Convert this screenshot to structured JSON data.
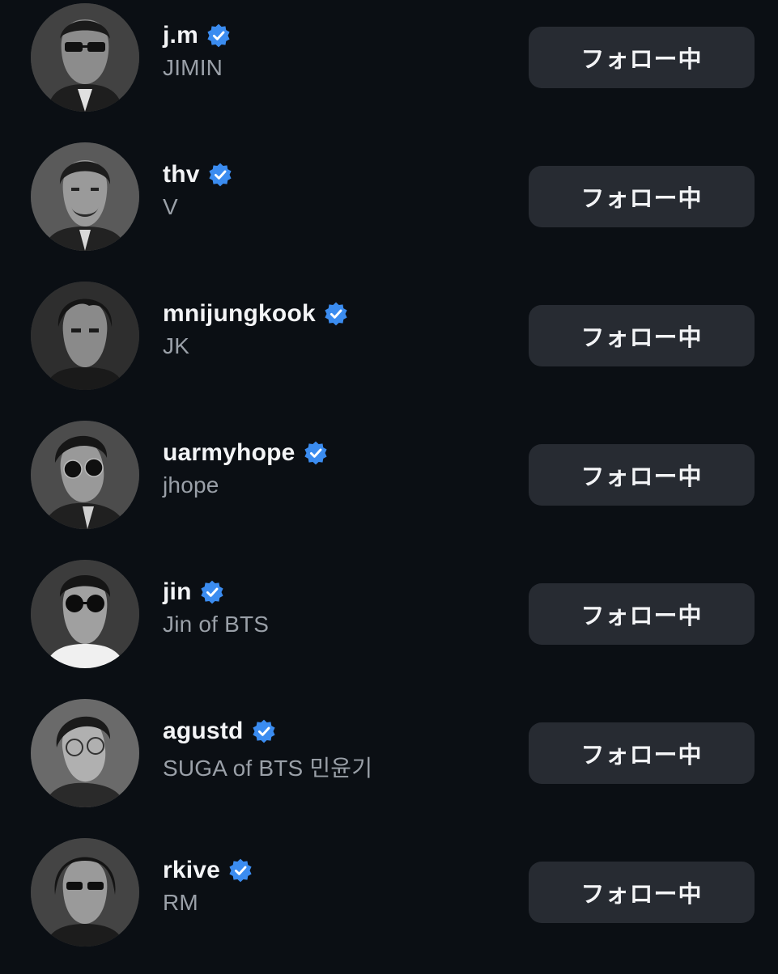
{
  "colors": {
    "background": "#0b0f14",
    "button_bg": "#272b32",
    "verified_blue": "#3b8cf0",
    "secondary_text": "#9aa0a8"
  },
  "accounts": [
    {
      "username": "j.m",
      "display_name": "JIMIN",
      "verified": true,
      "follow_label": "フォロー中",
      "avatar_icon": "avatar-photo"
    },
    {
      "username": "thv",
      "display_name": "V",
      "verified": true,
      "follow_label": "フォロー中",
      "avatar_icon": "avatar-photo"
    },
    {
      "username": "mnijungkook",
      "display_name": "JK",
      "verified": true,
      "follow_label": "フォロー中",
      "avatar_icon": "avatar-photo"
    },
    {
      "username": "uarmyhope",
      "display_name": "jhope",
      "verified": true,
      "follow_label": "フォロー中",
      "avatar_icon": "avatar-photo"
    },
    {
      "username": "jin",
      "display_name": "Jin of BTS",
      "verified": true,
      "follow_label": "フォロー中",
      "avatar_icon": "avatar-photo"
    },
    {
      "username": "agustd",
      "display_name": "SUGA of BTS 민윤기",
      "verified": true,
      "follow_label": "フォロー中",
      "avatar_icon": "avatar-photo"
    },
    {
      "username": "rkive",
      "display_name": "RM",
      "verified": true,
      "follow_label": "フォロー中",
      "avatar_icon": "avatar-photo"
    }
  ]
}
